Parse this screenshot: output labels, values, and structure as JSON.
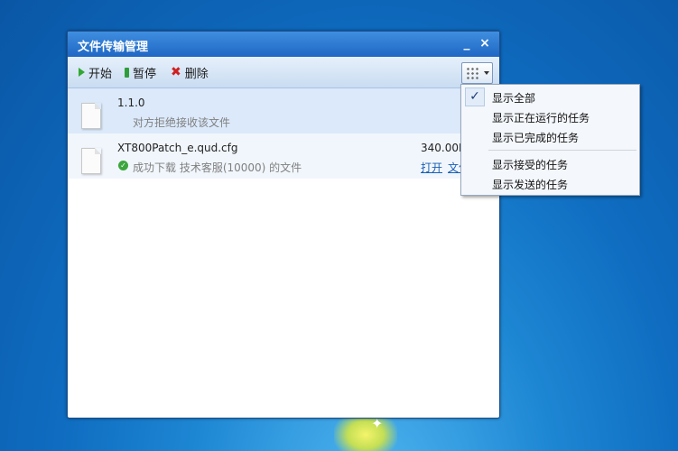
{
  "window": {
    "title": "文件传输管理",
    "minimize_label": "_",
    "close_label": "×"
  },
  "toolbar": {
    "start_label": "开始",
    "pause_label": "暂停",
    "delete_label": "删除"
  },
  "icons": {
    "start": "play-icon",
    "pause": "pause-icon",
    "delete": "delete-x-icon",
    "view": "grid-view-icon",
    "file": "file-icon",
    "success": "check-circle-icon"
  },
  "files": [
    {
      "name": "1.1.0",
      "status": "对方拒绝接收该文件"
    },
    {
      "name": "XT800Patch_e.qud.cfg",
      "status": "成功下载  技术客服(10000) 的文件",
      "size": "340.00B",
      "open_label": "打开",
      "folder_label": "文件夹"
    }
  ],
  "menu": {
    "checked": "✓",
    "items": [
      "显示全部",
      "显示正在运行的任务",
      "显示已完成的任务",
      "显示接受的任务",
      "显示发送的任务"
    ]
  }
}
